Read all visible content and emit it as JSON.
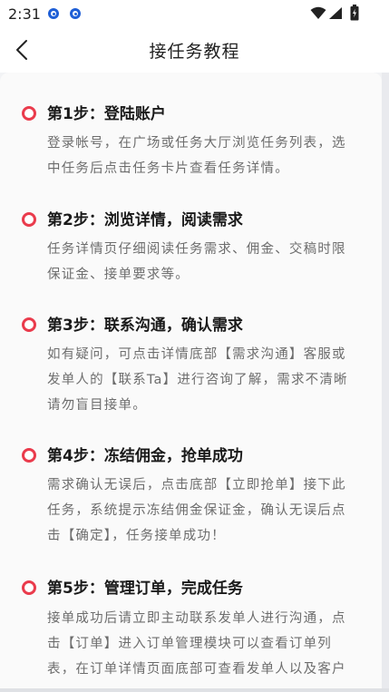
{
  "status_bar": {
    "time": "2:31",
    "icons": [
      "notification-icon",
      "notification-icon",
      "wifi-icon",
      "signal-icon",
      "battery-icon"
    ]
  },
  "header": {
    "back_icon": "chevron-left-icon",
    "title": "接任务教程"
  },
  "colors": {
    "accent": "#ea3b4c",
    "title_text": "#1a1a1a",
    "body_text": "#6d6d6d",
    "background": "#f2f3f5",
    "notif_blue": "#1f5fd6"
  },
  "steps": [
    {
      "title": "第1步：登陆账户",
      "lines": [
        "登录帐号，在广场或任务大厅浏览任务列表，选",
        "中任务后点击任务卡片查看任务详情。"
      ]
    },
    {
      "title": "第2步：浏览详情，阅读需求",
      "lines": [
        "任务详情页仔细阅读任务需求、佣金、交稿时限",
        "保证金、接单要求等。"
      ]
    },
    {
      "title": "第3步：联系沟通，确认需求",
      "lines": [
        "如有疑问，可点击详情底部【需求沟通】客服或",
        "发单人的【联系Ta】进行咨询了解，需求不清晰",
        "请勿盲目接单。"
      ]
    },
    {
      "title": "第4步：冻结佣金，抢单成功",
      "lines": [
        "需求确认无误后，点击底部【立即抢单】接下此",
        "任务，系统提示冻结佣金保证金，确认无误后点",
        "击【确定】，任务接单成功！"
      ]
    },
    {
      "title": "第5步：管理订单，完成任务",
      "lines": [
        "接单成功后请立即主动联系发单人进行沟通，点",
        "击【订单】进入订单管理模块可以查看订单列",
        "表，在订单详情页面底部可查看发单人以及客户"
      ]
    }
  ]
}
